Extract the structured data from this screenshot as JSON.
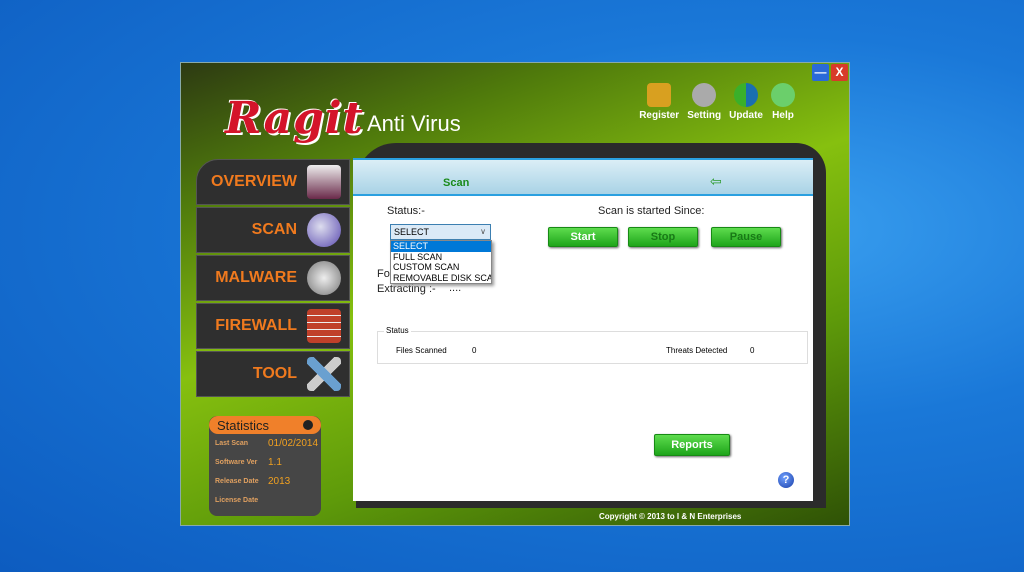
{
  "app": {
    "logo": "Ragit",
    "subtitle": "Anti Virus"
  },
  "titlebar": {
    "minimize": "—",
    "close": "X"
  },
  "top_menu": [
    {
      "label": "Register",
      "icon": "lock-icon",
      "color": "#d8a020"
    },
    {
      "label": "Setting",
      "icon": "gears-icon",
      "color": "#aaaaaa"
    },
    {
      "label": "Update",
      "icon": "refresh-icon",
      "color": "#1a6fb0"
    },
    {
      "label": "Help",
      "icon": "help-face-icon",
      "color": "#6bcf6b"
    }
  ],
  "sidebar": [
    {
      "label": "OVERVIEW",
      "icon": "monitor-icon",
      "color": "#6a2a4a"
    },
    {
      "label": "SCAN",
      "icon": "globe-icon",
      "color": "#5a4ab0"
    },
    {
      "label": "MALWARE",
      "icon": "bug-icon",
      "color": "#777777"
    },
    {
      "label": "FIREWALL",
      "icon": "brick-wall-icon",
      "color": "#c0402a"
    },
    {
      "label": "TOOL",
      "icon": "tools-icon",
      "color": "#6aa0d0"
    }
  ],
  "statistics": {
    "title": "Statistics",
    "rows": [
      {
        "label": "Last Scan",
        "value": "01/02/2014"
      },
      {
        "label": "Software Ver",
        "value": "1.1"
      },
      {
        "label": "Release Date",
        "value": "2013"
      },
      {
        "label": "License Date",
        "value": ""
      }
    ]
  },
  "panel": {
    "title": "Scan",
    "status_label": "Status:-",
    "since_label": "Scan is started Since:",
    "folder_label": "Fo",
    "extracting_label": "Extracting :-",
    "extracting_value": "....",
    "combo": {
      "value": "SELECT",
      "options": [
        "SELECT",
        "FULL SCAN",
        "CUSTOM SCAN",
        "REMOVABLE DISK SCAN"
      ]
    },
    "buttons": {
      "start": "Start",
      "stop": "Stop",
      "pause": "Pause",
      "reports": "Reports"
    },
    "group": {
      "title": "Status",
      "files_label": "Files Scanned",
      "files_value": "0",
      "threats_label": "Threats Detected",
      "threats_value": "0"
    }
  },
  "help_icon": "?",
  "copyright": "Copyright © 2013 to I & N Enterprises"
}
